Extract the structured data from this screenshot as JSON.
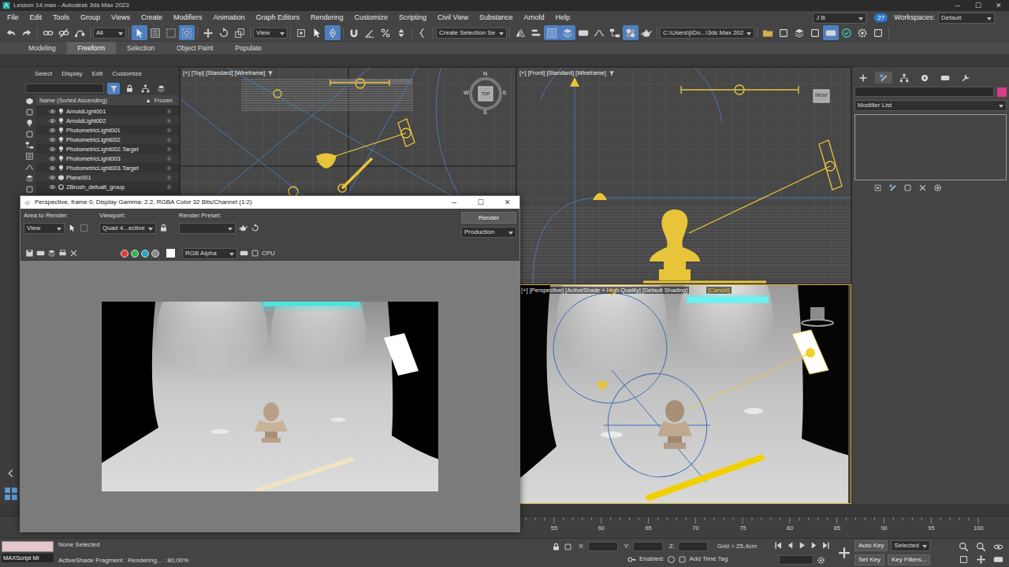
{
  "window": {
    "title": "Lesson 14.max - Autodesk 3ds Max 2023",
    "controls": [
      "─",
      "☐",
      "✕"
    ]
  },
  "menu": [
    "File",
    "Edit",
    "Tools",
    "Group",
    "Views",
    "Create",
    "Modifiers",
    "Animation",
    "Graph Editors",
    "Rendering",
    "Customize",
    "Scripting",
    "Civil View",
    "Substance",
    "Arnold",
    "Help"
  ],
  "account": {
    "user": "J B",
    "notifications": "27",
    "workspaces_label": "Workspaces:",
    "workspace": "Default"
  },
  "toolbar": {
    "selection_filter": "All",
    "reference_coord": "View",
    "selection_set": "Create Selection Se",
    "project_path": "C:\\Users\\j\\Do...\\3ds Max 202",
    "tools": [
      {
        "selected": false
      },
      {
        "selected": false
      },
      {
        "selected": false
      },
      {
        "selected": false
      },
      {
        "selected": false
      },
      {
        "selected": true
      },
      {
        "selected": false
      },
      {
        "selected": false
      },
      {
        "selected": true
      },
      {
        "selected": false
      },
      {
        "selected": false
      },
      {
        "selected": false
      },
      {
        "selected": false
      },
      {
        "selected": false
      },
      {
        "selected": true
      },
      {
        "selected": false
      },
      {
        "selected": false
      },
      {
        "selected": false
      },
      {
        "selected": false
      },
      {
        "selected": false
      },
      {
        "selected": false
      },
      {
        "selected": false
      },
      {
        "selected": true
      },
      {
        "selected": true
      },
      {
        "selected": false
      },
      {
        "selected": false
      },
      {
        "selected": false
      },
      {
        "selected": true
      },
      {
        "selected": false
      },
      {
        "selected": false
      },
      {
        "selected": false
      },
      {
        "selected": false
      },
      {
        "selected": false
      },
      {
        "selected": true
      },
      {
        "selected": false
      },
      {
        "selected": false
      },
      {
        "selected": false
      }
    ]
  },
  "ribbon_tabs": [
    {
      "label": "Modeling",
      "selected": false
    },
    {
      "label": "Freeform",
      "selected": true
    },
    {
      "label": "Selection",
      "selected": false
    },
    {
      "label": "Object Paint",
      "selected": false
    },
    {
      "label": "Populate",
      "selected": false
    }
  ],
  "scene_explorer": {
    "menu": [
      "Select",
      "Display",
      "Edit",
      "Customize"
    ],
    "filters": [
      {
        "selected": true
      },
      {
        "selected": false
      },
      {
        "selected": false
      },
      {
        "selected": false
      }
    ],
    "name_column": "Name (Sorted Ascending)",
    "sort_arrow": "▲",
    "frozen_column": "Frozen",
    "items": [
      {
        "name": "ArnoldLight001",
        "kind": "light",
        "visible": true
      },
      {
        "name": "ArnoldLight002",
        "kind": "light",
        "visible": true
      },
      {
        "name": "PhotometricLight001",
        "kind": "light",
        "visible": true
      },
      {
        "name": "PhotometricLight002",
        "kind": "light",
        "visible": true
      },
      {
        "name": "PhotometricLight002.Target",
        "kind": "light",
        "visible": true
      },
      {
        "name": "PhotometricLight003",
        "kind": "light",
        "visible": true
      },
      {
        "name": "PhotometricLight003.Target",
        "kind": "light",
        "visible": true
      },
      {
        "name": "Plane001",
        "kind": "geometry",
        "visible": true
      },
      {
        "name": "ZBrush_defualt_group",
        "kind": "group",
        "visible": true
      }
    ]
  },
  "viewports": {
    "top": {
      "label": "[+] [Top] [Standard] [Wireframe]",
      "compass": [
        "N",
        "W",
        "E",
        "S"
      ],
      "cube": "TOP"
    },
    "front": {
      "label": "[+] [Front] [Standard] [Wireframe]",
      "cube": "FRONT"
    },
    "perspective": {
      "label": "[+] [Perspective] [ActiveShade + High Quality] [Default Shading]",
      "cancel": "[Cancel]",
      "active": true
    }
  },
  "command_panel": {
    "tabs": [
      {
        "selected": false
      },
      {
        "selected": true
      },
      {
        "selected": false
      },
      {
        "selected": false
      },
      {
        "selected": false
      },
      {
        "selected": false
      }
    ],
    "modifier_list": "Modifier List"
  },
  "render_window": {
    "title": "Perspective, frame 0, Display Gamma: 2.2, RGBA Color 32 Bits/Channel (1:2)",
    "controls": [
      "─",
      "☐",
      "✕"
    ],
    "area_label": "Area to Render:",
    "area": "View",
    "viewport_label": "Viewport:",
    "viewport": "Quad 4...ective",
    "preset_label": "Render Preset:",
    "render_button": "Render",
    "production": "Production",
    "channels": [
      {
        "color": "#e53935"
      },
      {
        "color": "#2eb84b"
      },
      {
        "color": "#1fa3c9"
      },
      {
        "color": "#8a8a8a"
      }
    ],
    "display_channel": "RGB Alpha",
    "renderer": "CPU"
  },
  "timeline": {
    "ticks": [
      "55",
      "60",
      "65",
      "70",
      "75",
      "80",
      "85",
      "90",
      "95",
      "100"
    ]
  },
  "status_bar": {
    "maxscript": "MAXScript Mi",
    "selection": "None Selected",
    "prompt": "ActiveShade Fragment : Rendering... : 80,00%",
    "axes": [
      "X:",
      "Y:",
      "Z:"
    ],
    "grid": "Grid = 25,4cm",
    "enabled_label": "Enabled:",
    "time_tag": "Add Time Tag",
    "auto_key": "Auto Key",
    "key_mode": "Selected",
    "set_key": "Set Key",
    "key_filters": "Key Filters..."
  }
}
